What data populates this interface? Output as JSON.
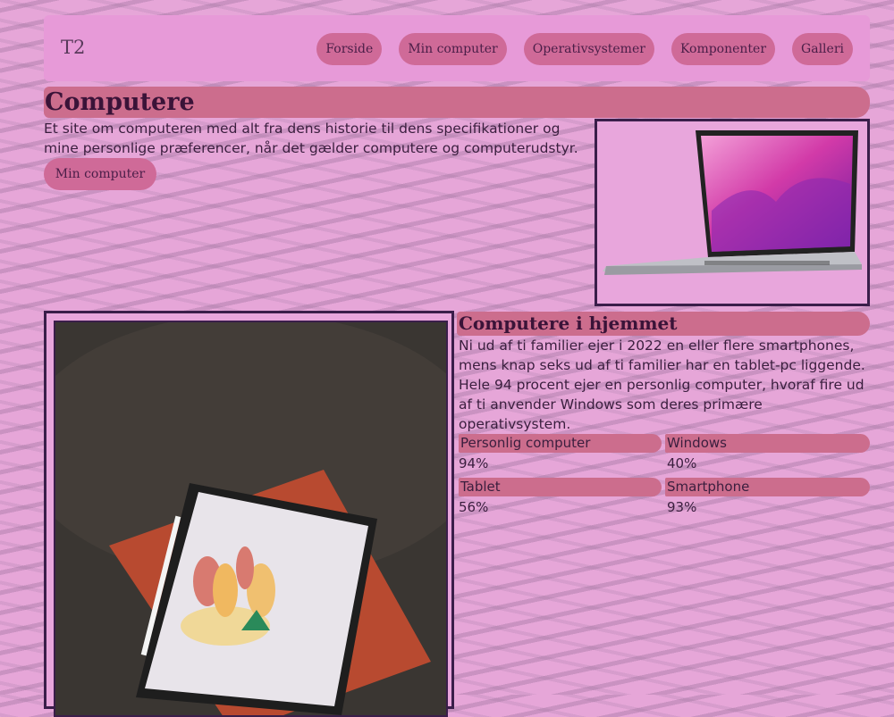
{
  "nav": {
    "brand": "T2",
    "links": [
      "Forside",
      "Min computer",
      "Operativsystemer",
      "Komponenter",
      "Galleri"
    ]
  },
  "hero": {
    "title": "Computere",
    "text": "Et site om computeren med alt fra dens historie til dens specifikationer og mine personlige præferencer, når det gælder computere og computerudstyr.",
    "button": "Min computer"
  },
  "section": {
    "title": "Computere i hjemmet",
    "text": "Ni ud af ti familier ejer i 2022 en eller flere smartphones, mens knap seks ud af ti familier har en tablet-pc liggende. Hele 94 procent ejer en personlig computer, hvoraf fire ud af ti anvender Windows som deres primære operativsystem.",
    "stats": [
      {
        "label": "Personlig computer",
        "value": "94%"
      },
      {
        "label": "Windows",
        "value": "40%"
      },
      {
        "label": "Tablet",
        "value": "56%"
      },
      {
        "label": "Smartphone",
        "value": "93%"
      }
    ]
  },
  "colors": {
    "background": "#e6a6d8",
    "nav_bg": "#e79ad8",
    "button": "#cf6a98",
    "heading_bar": "#cc6d8d",
    "frame_border": "#3a1e4a"
  }
}
